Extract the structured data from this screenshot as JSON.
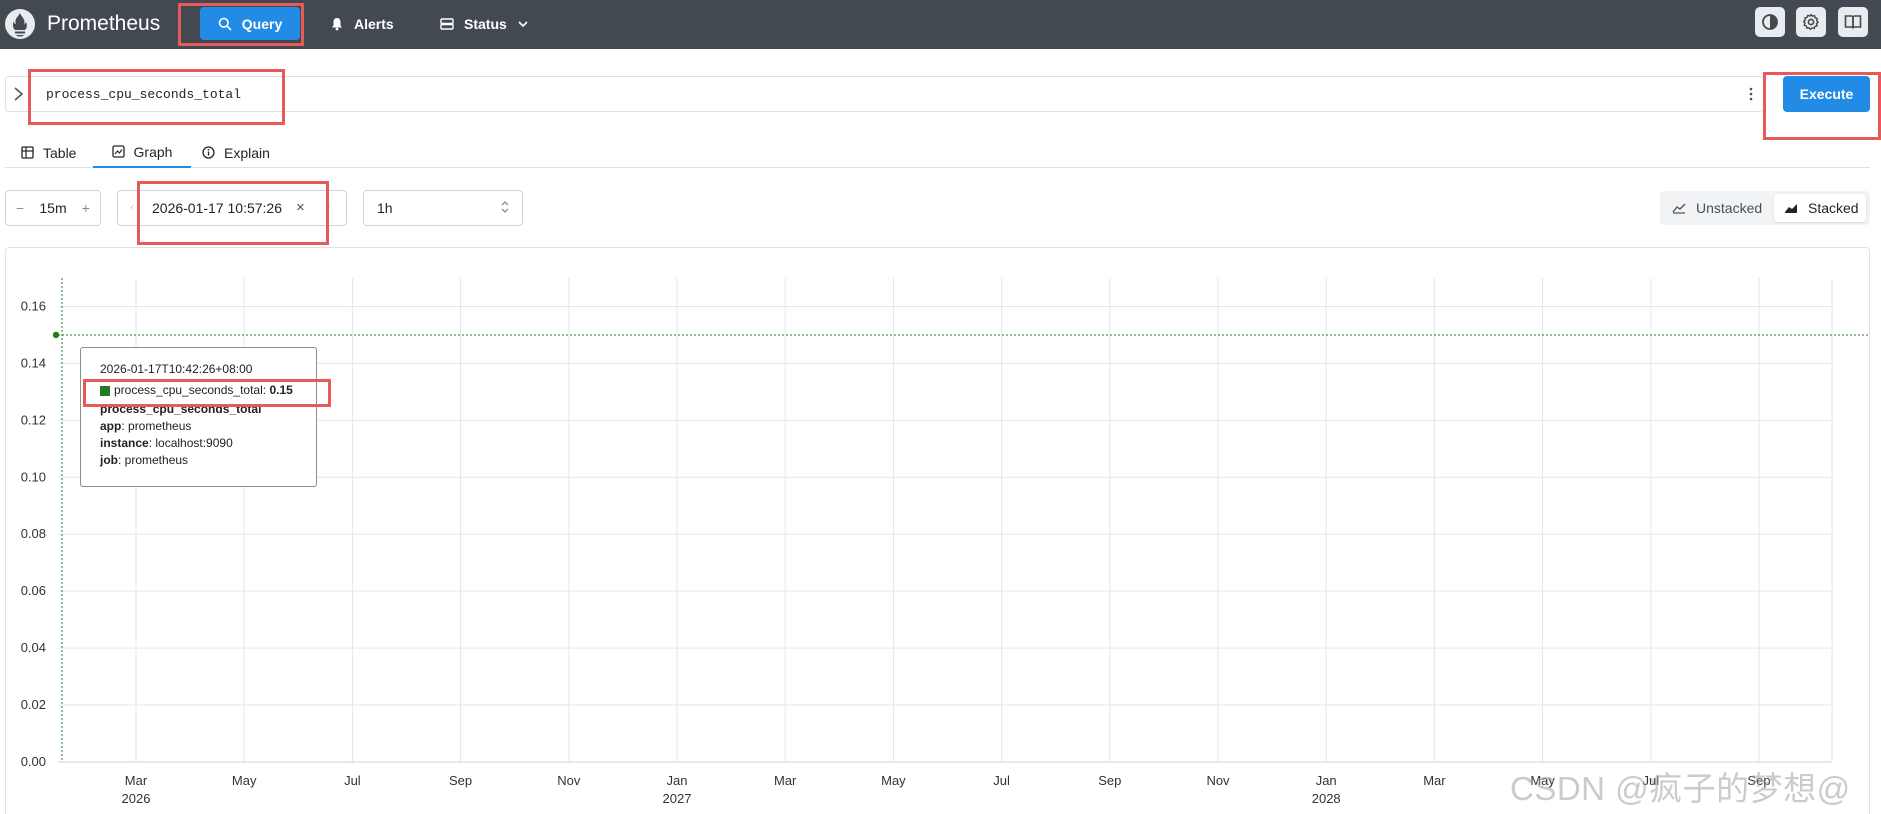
{
  "app": {
    "brand": "Prometheus"
  },
  "nav": [
    {
      "label": "Query"
    },
    {
      "label": "Alerts"
    },
    {
      "label": "Status"
    }
  ],
  "query": {
    "expression": "process_cpu_seconds_total",
    "execute_label": "Execute"
  },
  "tabs": [
    {
      "label": "Table",
      "active": false
    },
    {
      "label": "Graph",
      "active": true
    },
    {
      "label": "Explain",
      "active": false
    }
  ],
  "controls": {
    "range": "15m",
    "end_time": "2026-01-17 10:57:26",
    "resolution": "1h",
    "unstacked_label": "Unstacked",
    "stacked_label": "Stacked",
    "stacked_selected": true
  },
  "tooltip": {
    "timestamp": "2026-01-17T10:42:26+08:00",
    "series_name": "process_cpu_seconds_total",
    "series_value": "0.15",
    "metric": "process_cpu_seconds_total",
    "labels": [
      {
        "key": "app",
        "value": "prometheus"
      },
      {
        "key": "instance",
        "value": "localhost:9090"
      },
      {
        "key": "job",
        "value": "prometheus"
      }
    ]
  },
  "chart_data": {
    "type": "line",
    "y_ticks": [
      "0.00",
      "0.02",
      "0.04",
      "0.06",
      "0.08",
      "0.10",
      "0.12",
      "0.14",
      "0.16"
    ],
    "ylim": [
      0,
      0.17
    ],
    "x_ticks": [
      {
        "label": "Mar",
        "year": "2026"
      },
      {
        "label": "May",
        "year": ""
      },
      {
        "label": "Jul",
        "year": ""
      },
      {
        "label": "Sep",
        "year": ""
      },
      {
        "label": "Nov",
        "year": ""
      },
      {
        "label": "Jan",
        "year": "2027"
      },
      {
        "label": "Mar",
        "year": ""
      },
      {
        "label": "May",
        "year": ""
      },
      {
        "label": "Jul",
        "year": ""
      },
      {
        "label": "Sep",
        "year": ""
      },
      {
        "label": "Nov",
        "year": ""
      },
      {
        "label": "Jan",
        "year": "2028"
      },
      {
        "label": "Mar",
        "year": ""
      },
      {
        "label": "May",
        "year": ""
      },
      {
        "label": "Jul",
        "year": ""
      },
      {
        "label": "Sep",
        "year": ""
      }
    ],
    "series": [
      {
        "name": "process_cpu_seconds_total",
        "values": [
          0.15
        ]
      }
    ],
    "series_color": "#237a23",
    "grid": true
  },
  "watermark": "CSDN @疯子的梦想@"
}
